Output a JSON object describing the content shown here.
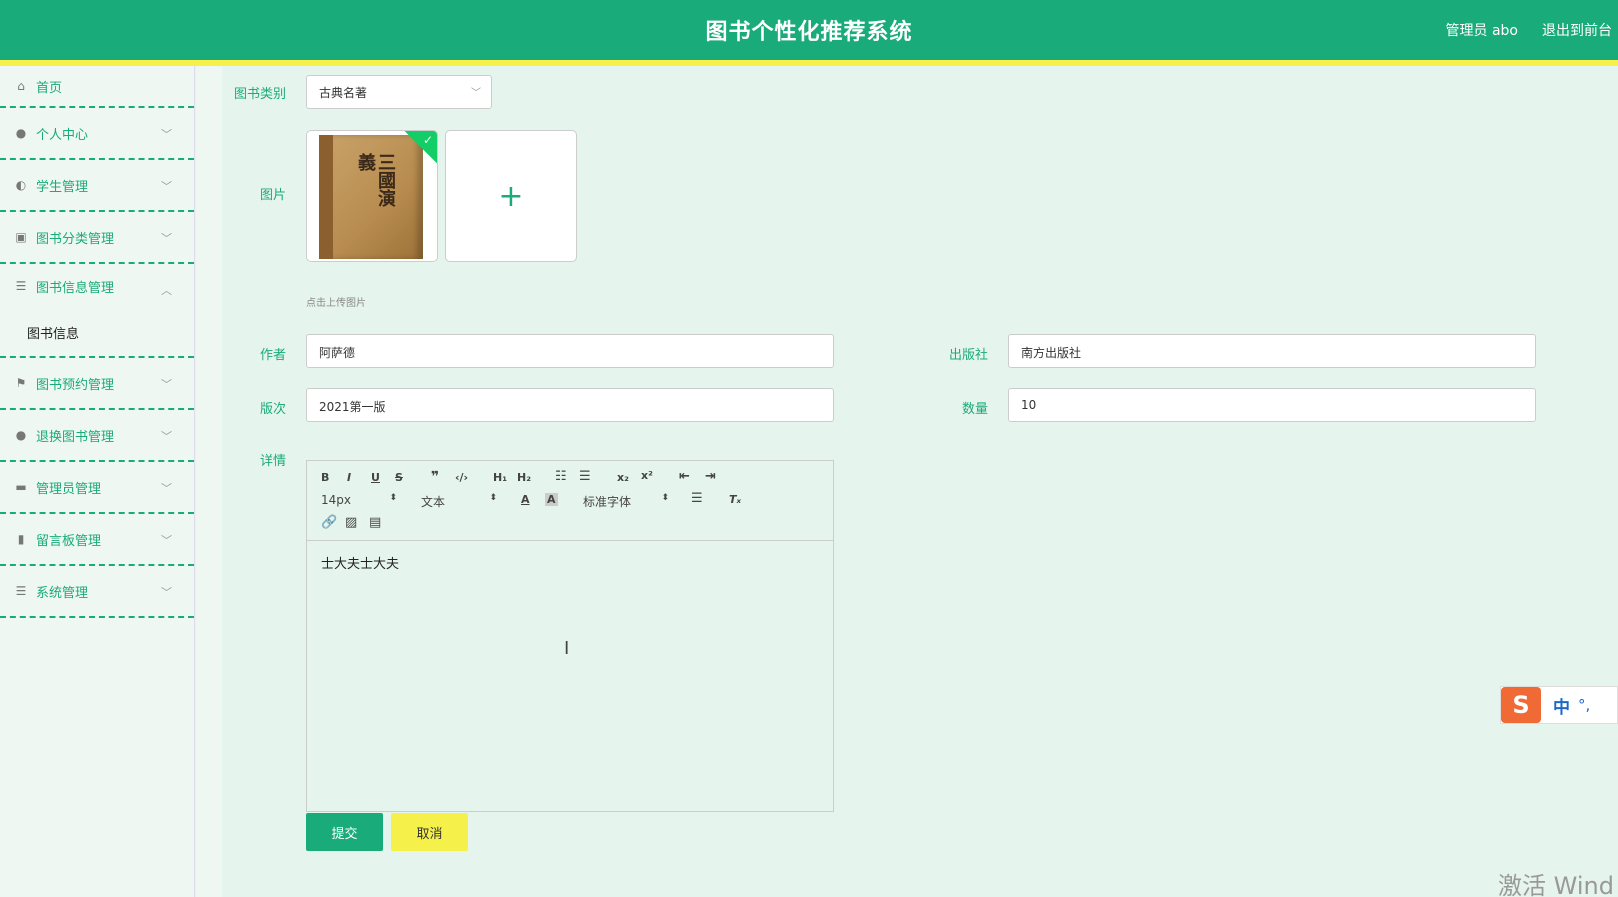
{
  "header": {
    "title": "图书个性化推荐系统",
    "user": "管理员 abo",
    "logout": "退出到前台"
  },
  "sidebar": {
    "items": [
      {
        "label": "首页",
        "icon": "home-icon",
        "chev": ""
      },
      {
        "label": "个人中心",
        "icon": "user-icon",
        "chev": "﹀"
      },
      {
        "label": "学生管理",
        "icon": "mic-icon",
        "chev": "﹀"
      },
      {
        "label": "图书分类管理",
        "icon": "chart-icon",
        "chev": "﹀"
      },
      {
        "label": "图书信息管理",
        "icon": "list-icon",
        "chev": "︿"
      },
      {
        "label": "图书预约管理",
        "icon": "flag-icon",
        "chev": "﹀"
      },
      {
        "label": "退换图书管理",
        "icon": "user-icon",
        "chev": "﹀"
      },
      {
        "label": "管理员管理",
        "icon": "monitor-icon",
        "chev": "﹀"
      },
      {
        "label": "留言板管理",
        "icon": "bar-chart-icon",
        "chev": "﹀"
      },
      {
        "label": "系统管理",
        "icon": "list-icon",
        "chev": "﹀"
      }
    ],
    "sub_item": "图书信息"
  },
  "form": {
    "category_label": "图书类别",
    "category_value": "古典名著",
    "image_label": "图片",
    "upload_hint": "点击上传图片",
    "book_title_chars": "三國演義",
    "author_label": "作者",
    "author_value": "阿萨德",
    "publisher_label": "出版社",
    "publisher_value": "南方出版社",
    "edition_label": "版次",
    "edition_value": "2021第一版",
    "quantity_label": "数量",
    "quantity_value": "10",
    "detail_label": "详情",
    "detail_content": "士大夫士大夫"
  },
  "editor": {
    "font_size": "14px",
    "heading": "文本",
    "font_family": "标准字体"
  },
  "buttons": {
    "submit": "提交",
    "cancel": "取消"
  },
  "ime": {
    "logo": "S",
    "lang": "中",
    "punc": "°,"
  },
  "watermark": "激活 Wind"
}
